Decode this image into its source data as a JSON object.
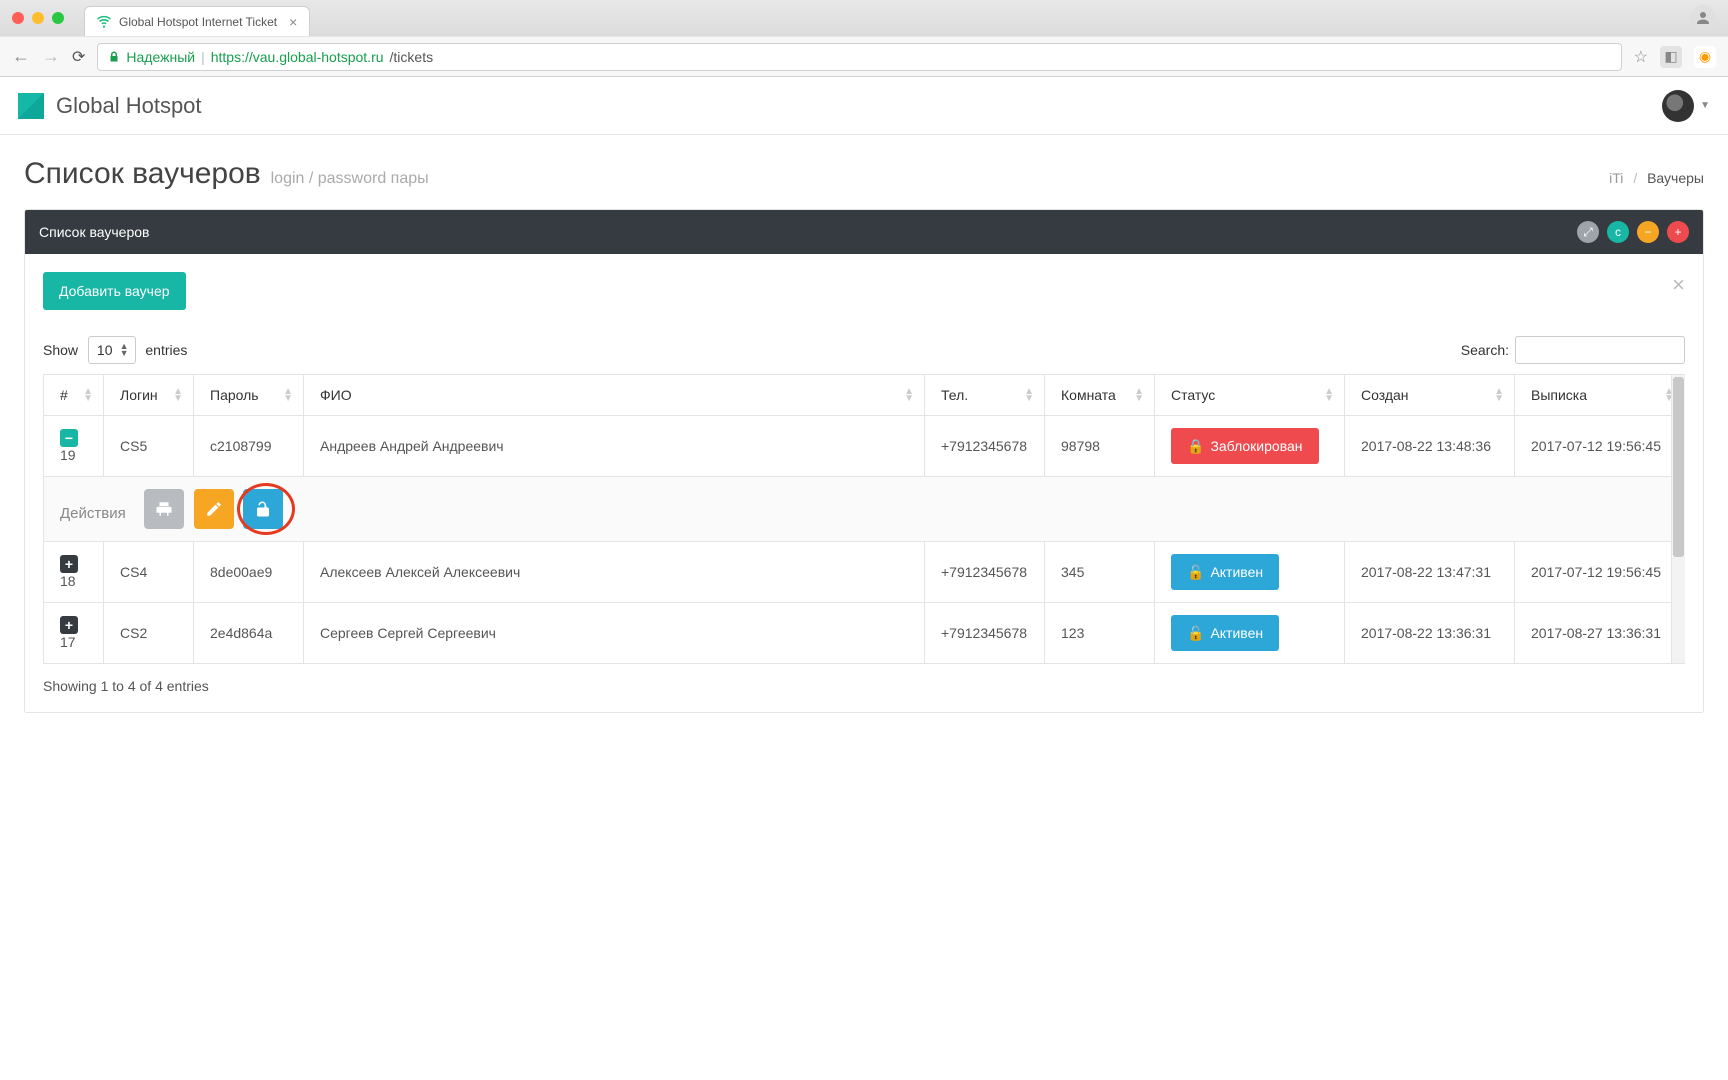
{
  "browser": {
    "tab_title": "Global Hotspot Internet Ticket",
    "secure_label": "Надежный",
    "url_scheme": "https://",
    "url_host": "vau.global-hotspot.ru",
    "url_path": "/tickets"
  },
  "app": {
    "name": "Global Hotspot"
  },
  "page": {
    "title": "Список ваучеров",
    "subtitle": "login / password пары",
    "breadcrumb": {
      "parent": "iTi",
      "current": "Ваучеры"
    }
  },
  "panel": {
    "title": "Список ваучеров",
    "add_button": "Добавить ваучер",
    "length_menu": {
      "prefix": "Show",
      "value": "10",
      "suffix": "entries"
    },
    "search_label": "Search:",
    "actions_label": "Действия",
    "showing": "Showing 1 to 4 of 4 entries"
  },
  "columns": {
    "hash": "#",
    "login": "Логин",
    "password": "Пароль",
    "name": "ФИО",
    "phone": "Тел.",
    "room": "Комната",
    "status": "Статус",
    "created": "Создан",
    "checkout": "Выписка"
  },
  "status_labels": {
    "blocked": "Заблокирован",
    "active": "Активен"
  },
  "rows": [
    {
      "id": "19",
      "login": "CS5",
      "password": "c2108799",
      "name": "Андреев Андрей Андреевич",
      "phone": "+7912345678",
      "room": "98798",
      "status": "blocked",
      "created": "2017-08-22 13:48:36",
      "checkout": "2017-07-12 19:56:45",
      "expanded": true
    },
    {
      "id": "18",
      "login": "CS4",
      "password": "8de00ae9",
      "name": "Алексеев Алексей Алексеевич",
      "phone": "+7912345678",
      "room": "345",
      "status": "active",
      "created": "2017-08-22 13:47:31",
      "checkout": "2017-07-12 19:56:45",
      "expanded": false
    },
    {
      "id": "17",
      "login": "CS2",
      "password": "2e4d864a",
      "name": "Сергеев Сергей Сергеевич",
      "phone": "+7912345678",
      "room": "123",
      "status": "active",
      "created": "2017-08-22 13:36:31",
      "checkout": "2017-08-27 13:36:31",
      "expanded": false
    }
  ]
}
